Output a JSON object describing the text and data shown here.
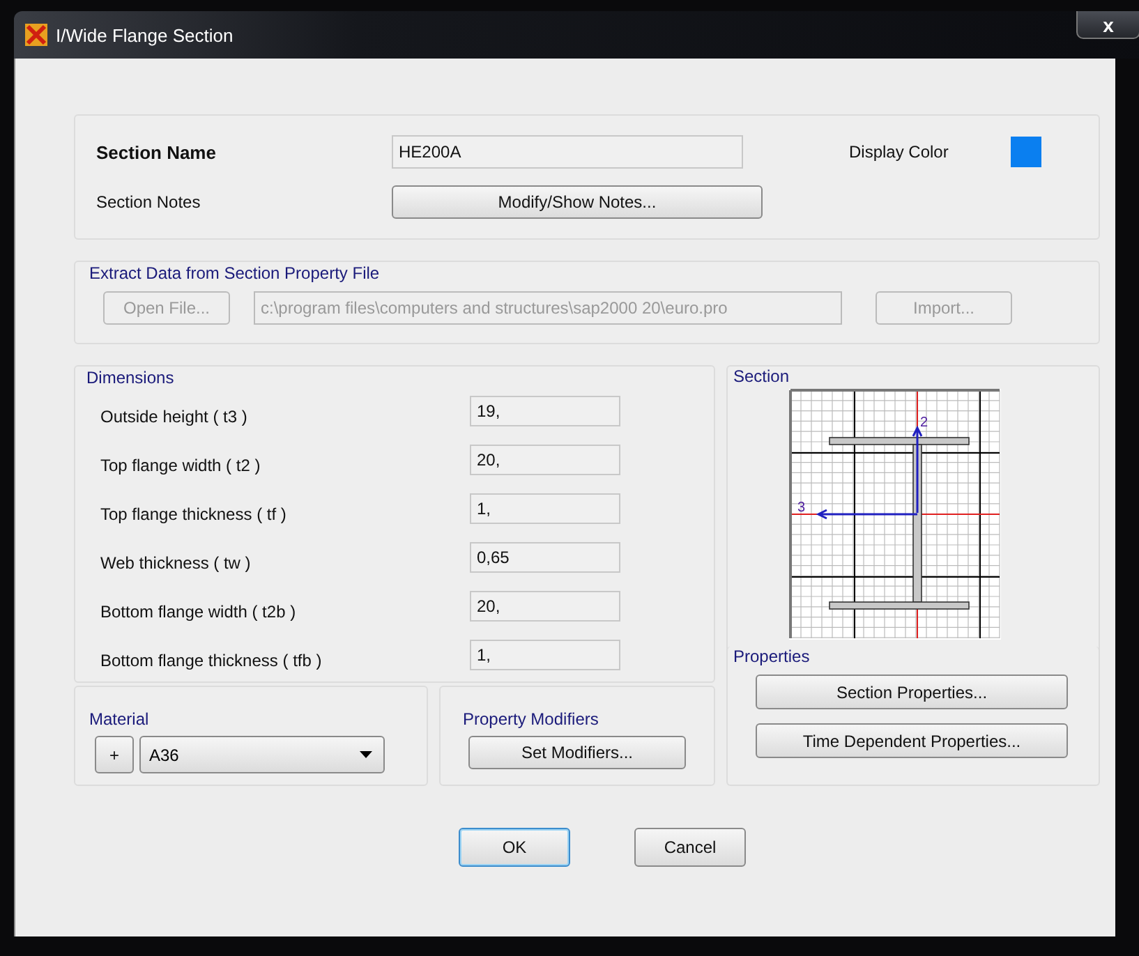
{
  "window": {
    "title": "I/Wide Flange Section",
    "close": "x"
  },
  "section_name": {
    "label": "Section Name",
    "value": "HE200A"
  },
  "display_color": {
    "label": "Display Color",
    "color": "#0a7ff0"
  },
  "section_notes": {
    "label": "Section Notes",
    "button": "Modify/Show Notes..."
  },
  "extract": {
    "title": "Extract Data from Section Property File",
    "open_button": "Open File...",
    "path": "c:\\program files\\computers and structures\\sap2000 20\\euro.pro",
    "import_button": "Import...",
    "disabled": true
  },
  "dimensions": {
    "title": "Dimensions",
    "fields": [
      {
        "label": "Outside height  ( t3 )",
        "value": "19,"
      },
      {
        "label": "Top flange width  ( t2 )",
        "value": "20,"
      },
      {
        "label": "Top flange thickness  ( tf )",
        "value": "1,"
      },
      {
        "label": "Web thickness  ( tw )",
        "value": "0,65"
      },
      {
        "label": "Bottom flange width  ( t2b )",
        "value": "20,"
      },
      {
        "label": "Bottom flange thickness  ( tfb )",
        "value": "1,"
      }
    ]
  },
  "section": {
    "title": "Section",
    "axis_2": "2",
    "axis_3": "3"
  },
  "material": {
    "title": "Material",
    "add_button": "+",
    "value": "A36"
  },
  "property_modifiers": {
    "title": "Property Modifiers",
    "button": "Set Modifiers..."
  },
  "properties": {
    "title": "Properties",
    "buttons": [
      "Section Properties...",
      "Time Dependent Properties..."
    ]
  },
  "buttons": [
    {
      "label": "OK",
      "default": true
    },
    {
      "label": "Cancel",
      "default": false
    }
  ]
}
